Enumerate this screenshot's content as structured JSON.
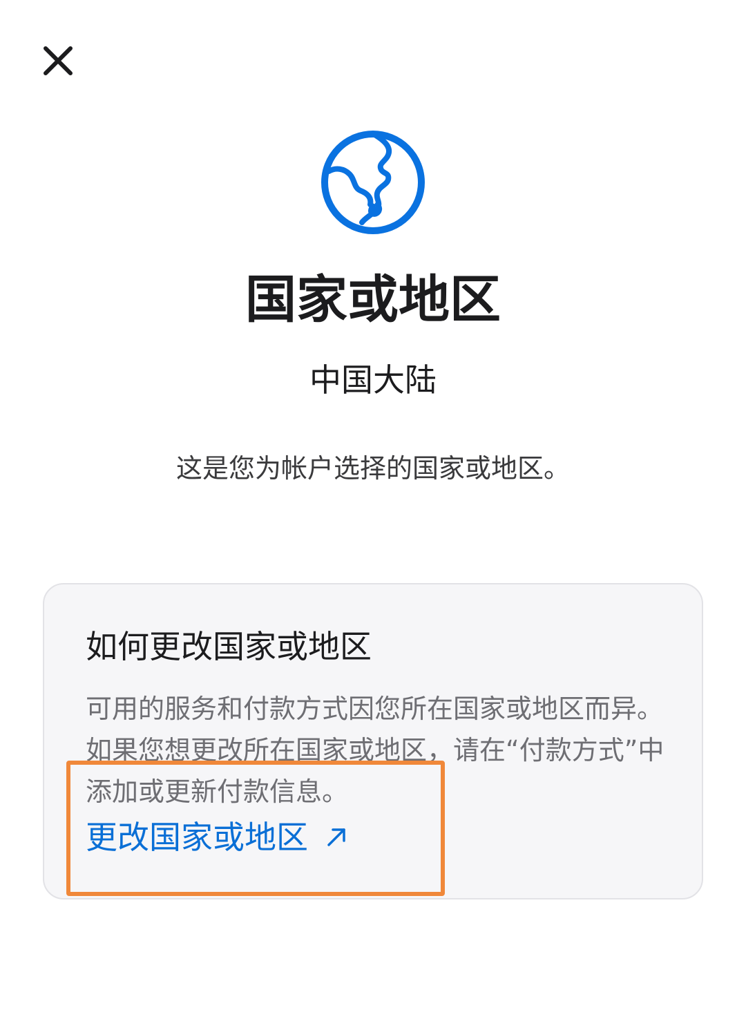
{
  "dialog": {
    "title": "国家或地区",
    "current_region": "中国大陆",
    "description": "这是您为帐户选择的国家或地区。"
  },
  "info_card": {
    "heading": "如何更改国家或地区",
    "body": "可用的服务和付款方式因您所在国家或地区而异。如果您想更改所在国家或地区，请在“付款方式”中添加或更新付款信息。",
    "link_label": "更改国家或地区"
  },
  "icons": {
    "close": "close-icon",
    "globe": "globe-icon",
    "external_link": "external-link-arrow-icon"
  },
  "colors": {
    "accent": "#0a6fd6",
    "globe": "#0a72e0",
    "highlight": "#f0883a",
    "card_background": "#f6f6f8"
  }
}
